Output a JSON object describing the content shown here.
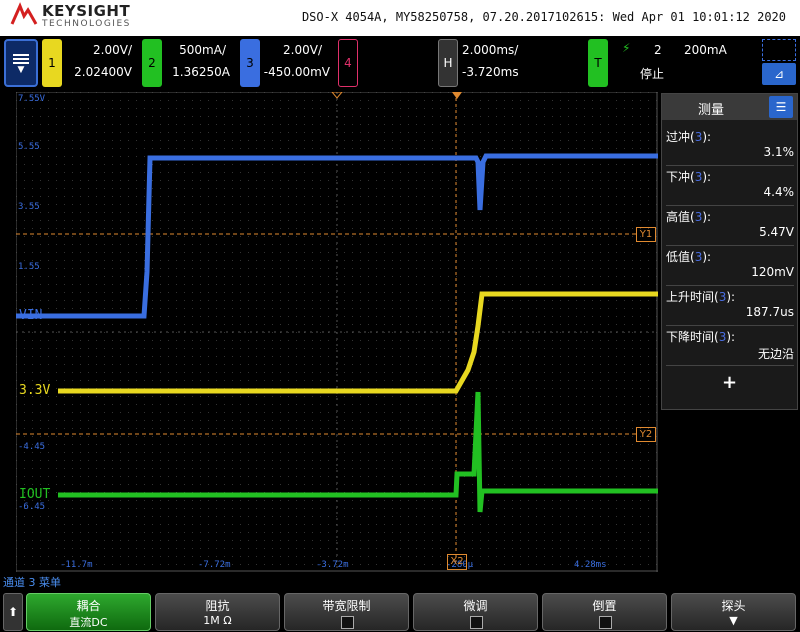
{
  "header": {
    "brand": "KEYSIGHT",
    "brand_sub": "TECHNOLOGIES",
    "title": "DSO-X 4054A, MY58250758, 07.20.2017102615: Wed Apr 01 10:01:12 2020"
  },
  "channels": {
    "ch1": {
      "num": "1",
      "scale": "2.00V/",
      "offset": "2.02400V",
      "color": "#e8d820"
    },
    "ch2": {
      "num": "2",
      "scale": "500mA/",
      "offset": "1.36250A",
      "color": "#22c022"
    },
    "ch3": {
      "num": "3",
      "scale": "2.00V/",
      "offset": "-450.00mV",
      "color": "#3a6ee0"
    },
    "ch4": {
      "num": "4",
      "color": "#e0306a"
    },
    "horizontal": {
      "label": "H",
      "scale": "2.000ms/",
      "delay": "-3.720ms"
    },
    "trigger": {
      "label": "T",
      "source": "2",
      "level": "200mA",
      "state": "停止"
    }
  },
  "screen": {
    "y_tick_labels": [
      "7.55V",
      "5.55",
      "3.55",
      "1.55",
      "-4.45",
      "-6.45"
    ],
    "x_tick_labels": [
      "-11.7m",
      "-7.72m",
      "-3.72m",
      "-280μ",
      "4.28ms"
    ],
    "trace_labels": {
      "ch3": "VIN",
      "ch1": "3.3V",
      "ch2": "IOUT"
    },
    "cursor_labels": {
      "y1": "Y1",
      "y2": "Y2",
      "x2": "X2"
    }
  },
  "measure": {
    "title": "测量",
    "items": [
      {
        "label": "过冲",
        "ch": "3",
        "value": "3.1%"
      },
      {
        "label": "下冲",
        "ch": "3",
        "value": "4.4%"
      },
      {
        "label": "高值",
        "ch": "3",
        "value": "5.47V"
      },
      {
        "label": "低值",
        "ch": "3",
        "value": "120mV"
      },
      {
        "label": "上升时间",
        "ch": "3",
        "value": "187.7us"
      },
      {
        "label": "下降时间",
        "ch": "3",
        "value": "无边沿"
      }
    ],
    "add_symbol": "+"
  },
  "status": "通道 3 菜单",
  "softkeys": [
    {
      "title": "耦合",
      "value": "直流DC"
    },
    {
      "title": "阻抗",
      "value": "1M Ω"
    },
    {
      "title": "带宽限制",
      "value": ""
    },
    {
      "title": "微调",
      "value": ""
    },
    {
      "title": "倒置",
      "value": ""
    },
    {
      "title": "探头",
      "value": ""
    }
  ]
}
